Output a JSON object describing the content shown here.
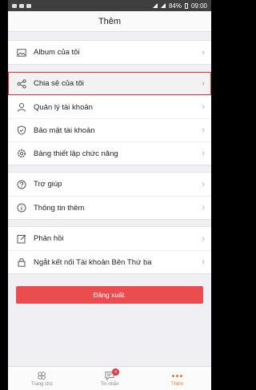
{
  "status_bar": {
    "battery": "84%",
    "time": "09:00"
  },
  "header": {
    "title": "Thêm"
  },
  "menu": {
    "group1": [
      {
        "label": "Album của tôi",
        "icon": "image-icon"
      }
    ],
    "group2": [
      {
        "label": "Chia sẻ của tôi",
        "icon": "share-icon"
      },
      {
        "label": "Quản lý tài khoản",
        "icon": "user-icon"
      },
      {
        "label": "Bảo mật tài khoản",
        "icon": "shield-icon"
      },
      {
        "label": "Bảng thiết lập chức năng",
        "icon": "gear-icon"
      }
    ],
    "group3": [
      {
        "label": "Trợ giúp",
        "icon": "help-icon"
      },
      {
        "label": "Thông tin thêm",
        "icon": "info-icon"
      }
    ],
    "group4": [
      {
        "label": "Phản hồi",
        "icon": "edit-icon"
      },
      {
        "label": "Ngắt kết nối Tài khoản Bên Thứ ba",
        "icon": "lock-icon"
      }
    ]
  },
  "logout_label": "Đăng xuất.",
  "tabs": [
    {
      "label": "Trang chủ",
      "icon": "home-icon"
    },
    {
      "label": "Tin nhắn",
      "icon": "chat-icon",
      "badge": "4"
    },
    {
      "label": "Thêm",
      "icon": "more-icon"
    }
  ],
  "colors": {
    "accent": "#e8792a",
    "logout": "#ea4d4d",
    "highlight_border": "#e0393e"
  }
}
